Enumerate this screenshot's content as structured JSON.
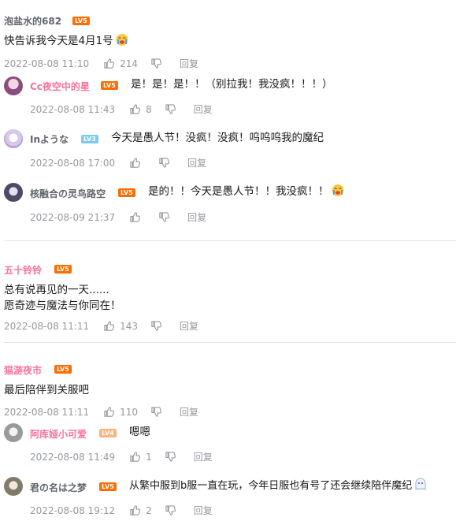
{
  "comments": [
    {
      "user": "泡盐水的682",
      "level": "LV5",
      "text": "快告诉我今天是4月1号",
      "date": "2022-08-08 11:10",
      "likes": "214",
      "reply_label": "回复",
      "replies": [
        {
          "user": "Cc夜空中的星",
          "level": "LV5",
          "text": "是！是！是！！（别拉我！我没疯！！！）",
          "date": "2022-08-08 11:43",
          "likes": "8",
          "reply_label": "回复"
        },
        {
          "user": "Inような",
          "level": "LV3",
          "text": "今天是愚人节！没疯！没疯！呜呜呜我的魔纪",
          "date": "2022-08-08 17:00",
          "likes": "",
          "reply_label": "回复"
        },
        {
          "user": "核融合の灵鸟路空",
          "level": "LV5",
          "text": "是的！！今天是愚人节！！我没疯！！",
          "date": "2022-08-09 21:37",
          "likes": "",
          "reply_label": "回复"
        }
      ]
    },
    {
      "user": "五十铃铃",
      "level": "LV5",
      "text_line1": "总有说再见的一天......",
      "text_line2": "愿奇迹与魔法与你同在！",
      "date": "2022-08-08 11:11",
      "likes": "143",
      "reply_label": "回复"
    },
    {
      "user": "猫游夜市",
      "level": "LV5",
      "text": "最后陪伴到关服吧",
      "date": "2022-08-08 11:11",
      "likes": "110",
      "reply_label": "回复",
      "replies": [
        {
          "user": "阿库娅小可爱",
          "level": "LV4",
          "text": "嗯嗯",
          "date": "2022-08-08 11:49",
          "likes": "1",
          "reply_label": "回复"
        },
        {
          "user": "君の名は之梦",
          "level": "LV5",
          "text": "从繁中服到b服一直在玩，今年日服也有号了还会继续陪伴魔纪",
          "date": "2022-08-08 19:12",
          "likes": "2",
          "reply_label": "回复"
        }
      ]
    }
  ],
  "icons": {
    "like": "thumbs-up-icon",
    "dislike": "thumbs-down-icon",
    "emoji_cry": "crying-emoji-icon",
    "emoji_ghost": "ghost-emoji-icon"
  }
}
